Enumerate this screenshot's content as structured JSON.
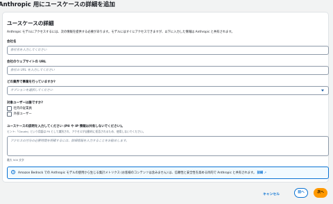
{
  "page": {
    "title": "Anthropic 用にユースケースの詳細を追加"
  },
  "card": {
    "title": "ユースケースの詳細",
    "description": "Anthropic モデルにアクセスするには、次の情報を提供する必要があります。モデルにはすぐにアクセスできますが、以下に入力した情報は Anthropic と共有されます。"
  },
  "fields": {
    "company_name": {
      "label": "会社名",
      "placeholder": "会社名を入力してください",
      "value": ""
    },
    "company_url": {
      "label": "会社のウェブサイトの URL",
      "placeholder": "会社の URL を入力してください",
      "value": ""
    },
    "industry": {
      "label": "どの業界で事業を行っていますか?",
      "placeholder": "オプションを選択してください",
      "value": ""
    },
    "target_users": {
      "label": "対象ユーザーは誰ですか?",
      "options": [
        {
          "label": "社内の従業員",
          "checked": false
        },
        {
          "label": "外部ユーザー",
          "checked": false
        }
      ]
    },
    "use_case": {
      "label": "ユースケースの説明を入力してください (PII や IP 情報は共有しないでください)。",
      "hint": "ヒント:「Claude」という用語は PII として識別され、アクセスが自動的に拒否されるため、使用しないでください。",
      "placeholder": "アクセスの付与の必要時間を明確するには、詳細情報を入力することをお勧めします。",
      "value": "",
      "char_limit": "最大 500 文字"
    }
  },
  "info": {
    "text": "Amazon Bedrock での Anthropic モデルの使用から生じる集計メトリクス (お客様のコンテンツは含みません) は、信頼性と安全性を高める目的で Anthropic と共有されます。",
    "link_label": "詳細",
    "icon": "info-icon",
    "link_icon": "external-link-icon"
  },
  "actions": {
    "cancel_label": "キャンセル",
    "prev_label": "前へ",
    "next_label": "次へ"
  },
  "colors": {
    "accent": "#0972d3",
    "primary_button": "#ff9900",
    "background": "#f2f3f3"
  }
}
